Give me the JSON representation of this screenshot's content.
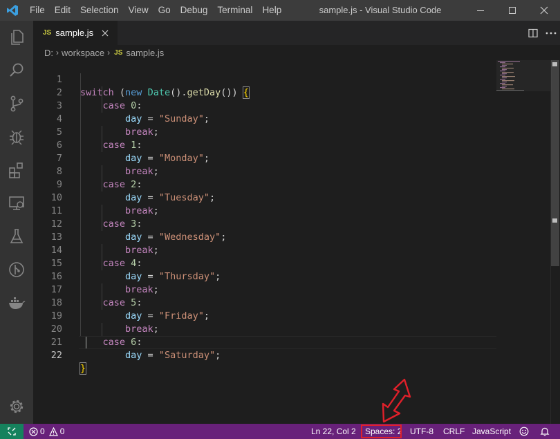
{
  "window": {
    "title": "sample.js - Visual Studio Code",
    "menu": [
      "File",
      "Edit",
      "Selection",
      "View",
      "Go",
      "Debug",
      "Terminal",
      "Help"
    ]
  },
  "tab": {
    "badge": "JS",
    "label": "sample.js"
  },
  "breadcrumb": {
    "drive": "D:",
    "folder": "workspace",
    "badge": "JS",
    "file": "sample.js"
  },
  "editor": {
    "lines": [
      {
        "n": "1"
      },
      {
        "n": "2"
      },
      {
        "n": "3"
      },
      {
        "n": "4"
      },
      {
        "n": "5"
      },
      {
        "n": "6"
      },
      {
        "n": "7"
      },
      {
        "n": "8"
      },
      {
        "n": "9"
      },
      {
        "n": "10"
      },
      {
        "n": "11"
      },
      {
        "n": "12"
      },
      {
        "n": "13"
      },
      {
        "n": "14"
      },
      {
        "n": "15"
      },
      {
        "n": "16"
      },
      {
        "n": "17"
      },
      {
        "n": "18"
      },
      {
        "n": "19"
      },
      {
        "n": "20"
      },
      {
        "n": "21"
      },
      {
        "n": "22"
      }
    ],
    "tokens": {
      "switch": "switch",
      "new": "new",
      "Date": "Date",
      "getDay": "getDay",
      "case": "case",
      "day": "day",
      "break": "break",
      "days": [
        "\"Sunday\"",
        "\"Monday\"",
        "\"Tuesday\"",
        "\"Wednesday\"",
        "\"Thursday\"",
        "\"Friday\"",
        "\"Saturday\""
      ],
      "nums": [
        "0",
        "1",
        "2",
        "3",
        "4",
        "5",
        "6"
      ]
    }
  },
  "statusbar": {
    "errors": "0",
    "warnings": "0",
    "position": "Ln 22, Col 2",
    "spaces": "Spaces: 2",
    "encoding": "UTF-8",
    "eol": "CRLF",
    "language": "JavaScript"
  },
  "colors": {
    "statusbar": "#68217a",
    "remote": "#16825d",
    "highlight": "#e0202a"
  }
}
